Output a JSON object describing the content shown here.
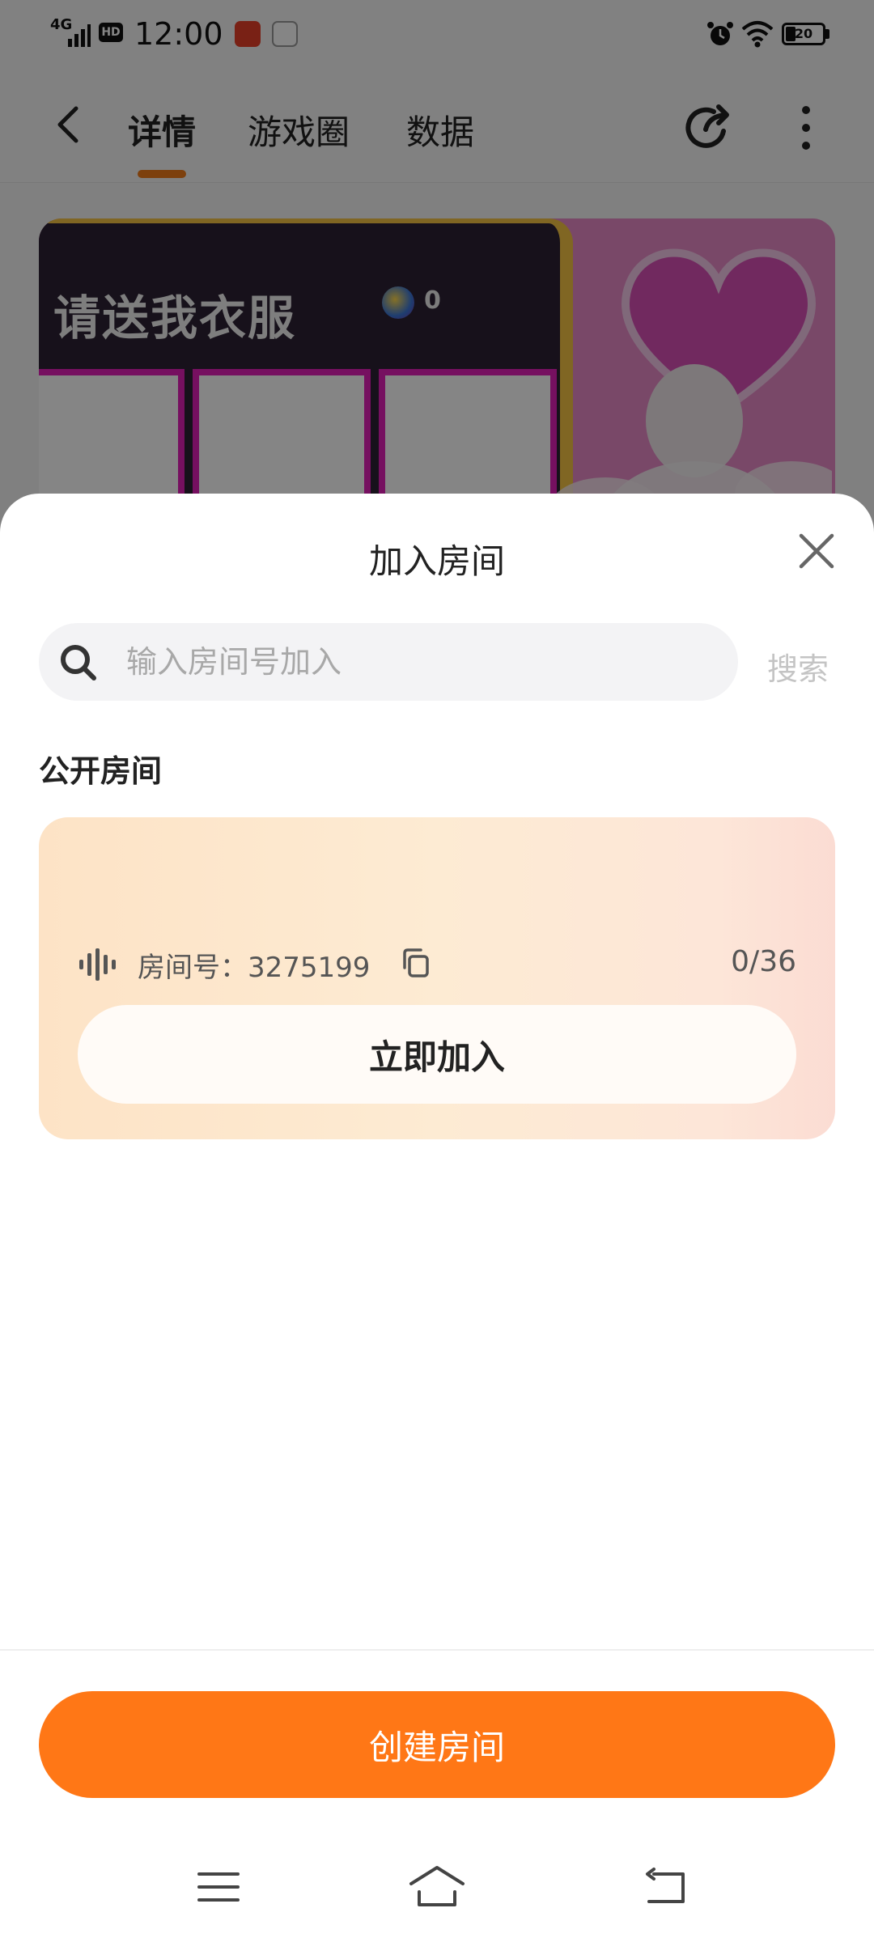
{
  "status_bar": {
    "network": "4G",
    "hd_badge": "HD",
    "time": "12:00",
    "battery_level": "20",
    "icons": [
      "signal-icon",
      "app-notification-icon",
      "vivo-icon",
      "alarm-icon",
      "wifi-icon",
      "battery-icon"
    ]
  },
  "top_nav": {
    "tabs": [
      {
        "label": "详情",
        "active": true
      },
      {
        "label": "游戏圈",
        "active": false
      },
      {
        "label": "数据",
        "active": false
      }
    ],
    "accent_color": "#f07c1a",
    "icons": [
      "back-arrow-icon",
      "share-icon",
      "more-vertical-icon"
    ]
  },
  "banner": {
    "title": "请送我衣服",
    "coin_count": "0"
  },
  "sheet": {
    "title": "加入房间",
    "search": {
      "placeholder": "输入房间号加入",
      "value": "",
      "button_label": "搜索"
    },
    "section_title": "公开房间",
    "rooms": [
      {
        "label": "房间号：3275199",
        "occupancy": "0/36",
        "join_label": "立即加入"
      }
    ],
    "create_label": "创建房间",
    "create_color": "#ff7716"
  },
  "system_nav": {
    "icons": [
      "menu-icon",
      "home-icon",
      "back-icon"
    ]
  }
}
